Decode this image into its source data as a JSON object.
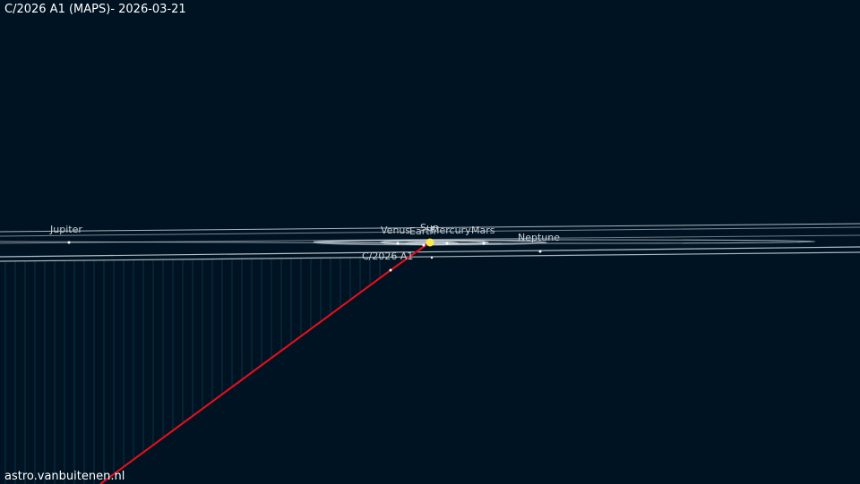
{
  "title": "C/2026 A1 (MAPS)- 2026-03-21",
  "credit": "astro.vanbuitenen.nl",
  "colors": {
    "background": "#001322",
    "orbit": "#c8d2d8",
    "comet_track": "#c00010",
    "drop_lines": "#1e5a7a",
    "sun": "#ffe94a"
  },
  "bodies": [
    {
      "name": "Jupiter",
      "label": "Jupiter"
    },
    {
      "name": "Venus",
      "label": "Venus"
    },
    {
      "name": "Earth",
      "label": "Earth"
    },
    {
      "name": "Sun",
      "label": "Sun"
    },
    {
      "name": "Mercury",
      "label": "Mercury"
    },
    {
      "name": "Mars",
      "label": "Mars"
    },
    {
      "name": "Neptune",
      "label": "Neptune"
    },
    {
      "name": "Comet",
      "label": "C/2026 A1"
    }
  ]
}
